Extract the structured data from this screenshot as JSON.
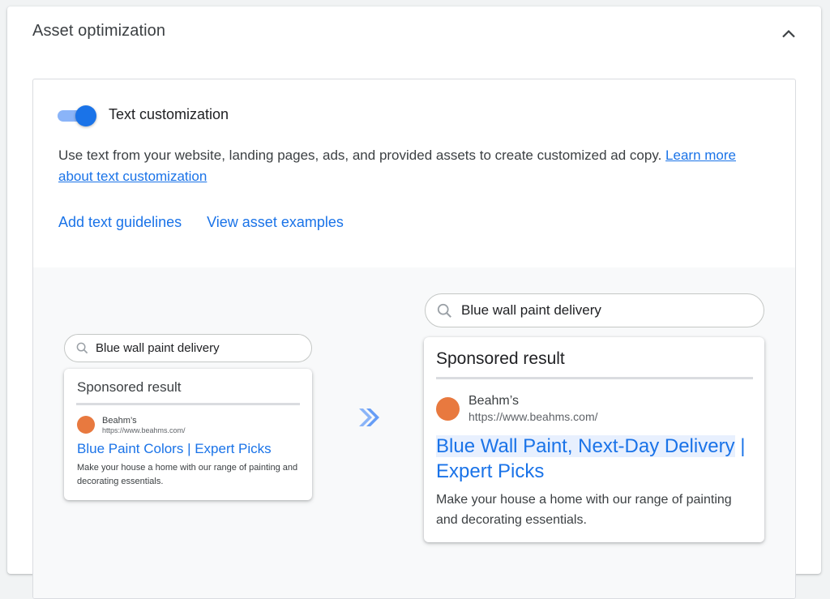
{
  "section": {
    "title": "Asset optimization",
    "collapse_icon": "chevron-up-icon"
  },
  "text_customization": {
    "label": "Text customization",
    "enabled": true,
    "toggle_color": "#1a73e8",
    "description": "Use text from your website, landing pages, ads, and provided assets to create customized ad copy.",
    "learn_more_link": "Learn more about text customization"
  },
  "actions": {
    "add_guidelines": "Add text guidelines",
    "view_examples": "View asset examples"
  },
  "illustration": {
    "before": {
      "search_query": "Blue wall paint delivery",
      "header": "Sponsored result",
      "advertiser": "Beahm’s",
      "url": "https://www.beahms.com/",
      "headline": "Blue Paint Colors | Expert Picks",
      "body": "Make your house a home with our range of painting and decorating essentials."
    },
    "after": {
      "search_query": "Blue wall paint delivery",
      "header": "Sponsored result",
      "advertiser": "Beahm’s",
      "url": "https://www.beahms.com/",
      "headline_highlighted": "Blue Wall Paint, Next-Day Delivery",
      "headline_rest": " | Expert Picks",
      "body": "Make your house a home with our range of painting and decorating essentials."
    },
    "arrow_icon": "double-chevron-right-icon",
    "logo_color": "#e8793f",
    "link_color": "#1a73e8"
  }
}
